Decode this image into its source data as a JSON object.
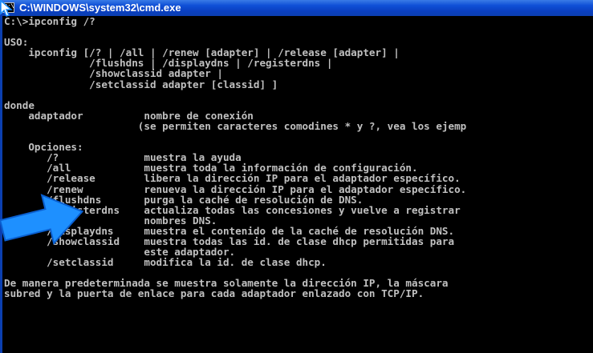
{
  "window": {
    "title": "C:\\WINDOWS\\system32\\cmd.exe",
    "icon_text": "C:\\"
  },
  "console": {
    "lines": [
      "C:\\>ipconfig /?",
      "",
      "USO:",
      "    ipconfig [/? | /all | /renew [adapter] | /release [adapter] |",
      "              /flushdns | /displaydns | /registerdns |",
      "              /showclassid adapter |",
      "              /setclassid adapter [classid] ]",
      "",
      "donde",
      "    adaptador          nombre de conexión",
      "                      (se permiten caracteres comodines * y ?, vea los ejemp",
      "",
      "    Opciones:",
      "       /?              muestra la ayuda",
      "       /all            muestra toda la información de configuración.",
      "       /release        libera la dirección IP para el adaptador específico.",
      "       /renew          renueva la dirección IP para el adaptador específico.",
      "       /flushdns       purga la caché de resolución de DNS.",
      "       /registerdns    actualiza todas las concesiones y vuelve a registrar",
      "                       nombres DNS.",
      "       /displaydns     muestra el contenido de la caché de resolución DNS.",
      "       /showclassid    muestra todas las id. de clase dhcp permitidas para",
      "                       este adaptador.",
      "       /setclassid     modifica la id. de clase dhcp.",
      "",
      "De manera predeterminada se muestra solamente la dirección IP, la máscara",
      "subred y la puerta de enlace para cada adaptador enlazado con TCP/IP."
    ]
  },
  "colors": {
    "titlebar": "#0b3fb0",
    "console_bg": "#000000",
    "console_text": "#c0c0c0",
    "arrow": "#1e90ff"
  },
  "icons": {
    "cursor": "mouse-pointer-icon",
    "highlight": "pointer-arrow-icon"
  }
}
